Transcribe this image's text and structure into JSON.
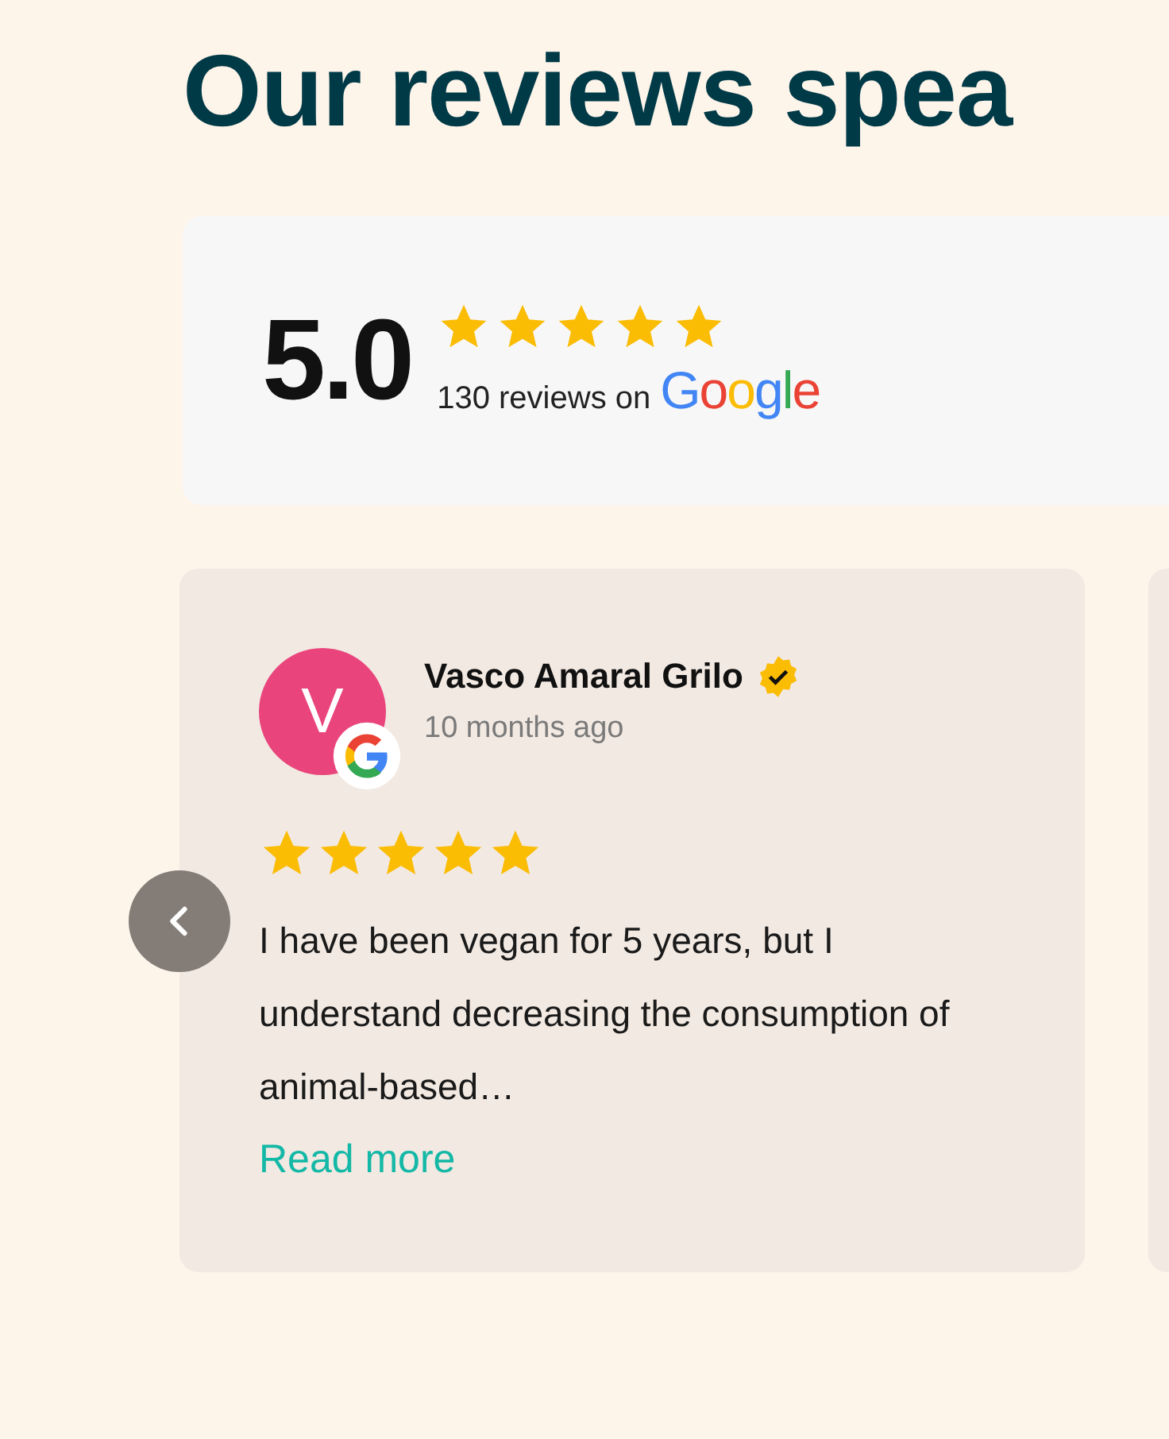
{
  "heading": "Our reviews spea",
  "summary": {
    "score": "5.0",
    "stars": 5,
    "count_text": "130 reviews on",
    "logo": "Google"
  },
  "reviews": [
    {
      "initial": "V",
      "color": "#e9457c",
      "name": "Vasco Amaral Grilo",
      "verified": true,
      "time": "10 months ago",
      "stars": 5,
      "text": "I have been vegan for 5 years, but I understand decreasing the consumption of animal-based…",
      "link": "Read more"
    }
  ]
}
